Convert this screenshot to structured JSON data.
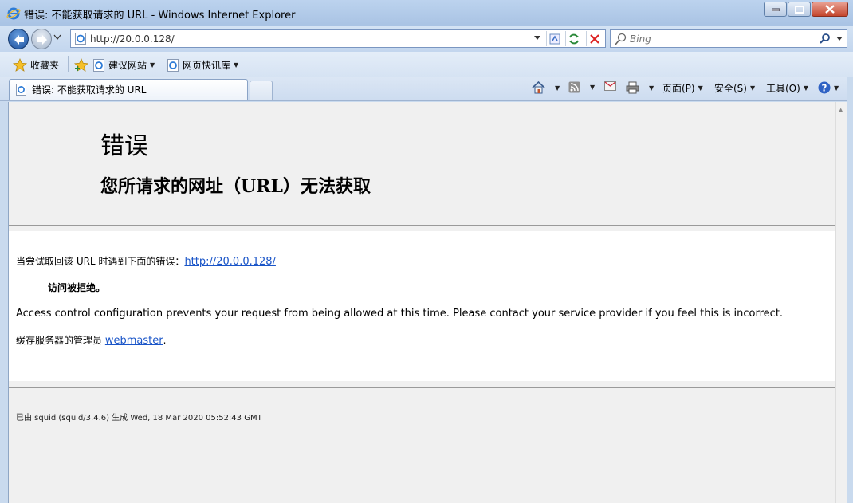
{
  "window": {
    "title": "错误: 不能获取请求的 URL - Windows Internet Explorer"
  },
  "address_bar": {
    "url": "http://20.0.0.128/",
    "search_placeholder": "Bing"
  },
  "favorites_bar": {
    "favorites_label": "收藏夹",
    "items": [
      "建议网站",
      "网页快讯库"
    ]
  },
  "tabs": [
    {
      "label": "错误: 不能获取请求的 URL"
    }
  ],
  "command_bar": {
    "page": "页面(P)",
    "safety": "安全(S)",
    "tools": "工具(O)"
  },
  "page": {
    "heading": "错误",
    "subheading": "您所请求的网址（URL）无法获取",
    "intro_text": "当尝试取回该  URL 时遇到下面的错误：",
    "intro_link": "http://20.0.0.128/",
    "error_title": "访问被拒绝。",
    "description": "Access control configuration prevents your request from being allowed at this time. Please contact your service provider if you feel this is incorrect.",
    "admin_text": "缓存服务器的管理员  ",
    "admin_link": "webmaster",
    "admin_suffix": ".",
    "footer": "已由 squid (squid/3.4.6) 生成 Wed, 18 Mar 2020 05:52:43 GMT"
  }
}
